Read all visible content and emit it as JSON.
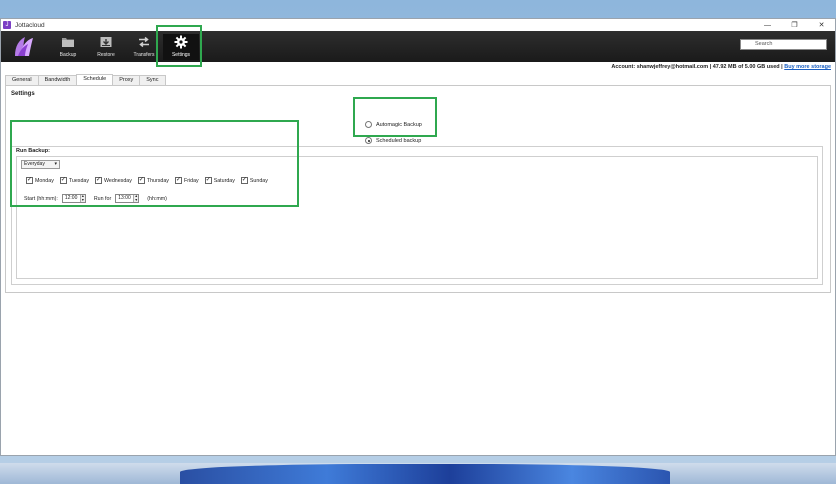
{
  "window": {
    "title": "Jottacloud",
    "controls": {
      "minimize": "—",
      "maximize": "❐",
      "close": "✕"
    }
  },
  "toolbar": {
    "items": [
      {
        "label": "Backup",
        "icon": "folder-icon"
      },
      {
        "label": "Restore",
        "icon": "download-box-icon"
      },
      {
        "label": "Transfers",
        "icon": "arrows-swap-icon"
      },
      {
        "label": "Settings",
        "icon": "gear-icon",
        "active": true
      }
    ],
    "search_placeholder": "Search"
  },
  "account": {
    "text": "Account: shanwjeffrey@hotmail.com | 47.92 MB of 5.00 GB used |",
    "link": "Buy more storage"
  },
  "tabs": [
    "General",
    "Bandwidth",
    "Schedule",
    "Proxy",
    "Sync"
  ],
  "active_tab": "Schedule",
  "settings": {
    "heading": "Settings",
    "mode_options": [
      {
        "label": "Automagic Backup",
        "selected": false
      },
      {
        "label": "Scheduled backup",
        "selected": true
      }
    ],
    "run_backup": {
      "label": "Run Backup:",
      "frequency": "Everyday",
      "days": [
        {
          "label": "Monday",
          "checked": true
        },
        {
          "label": "Tuesday",
          "checked": true
        },
        {
          "label": "Wednesday",
          "checked": true
        },
        {
          "label": "Thursday",
          "checked": true
        },
        {
          "label": "Friday",
          "checked": true
        },
        {
          "label": "Saturday",
          "checked": true
        },
        {
          "label": "Sunday",
          "checked": true
        }
      ],
      "start_label": "Start (hh:mm):",
      "start_value": "12:00",
      "run_for_label": "Run for",
      "run_for_value": "13:00",
      "run_for_unit": "(hh:mm)"
    }
  },
  "colors": {
    "highlight": "#2fa84f",
    "toolbar_bg": "#1f1f1f",
    "brand_purple": "#7a3fc4",
    "link": "#1a5fc2"
  }
}
